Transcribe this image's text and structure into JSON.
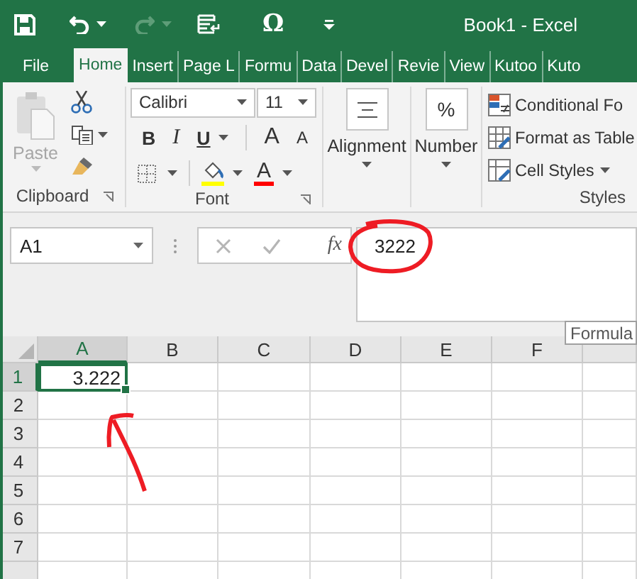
{
  "window": {
    "title": "Book1 - Excel"
  },
  "quick_access": [
    {
      "kind": "save",
      "disabled": false
    },
    {
      "kind": "undo",
      "disabled": false
    },
    {
      "kind": "redo",
      "disabled": true
    },
    {
      "kind": "touch",
      "disabled": false
    },
    {
      "kind": "symbol",
      "label": "Ω",
      "disabled": false
    },
    {
      "kind": "customize",
      "disabled": false
    }
  ],
  "tabs": [
    {
      "label": "File",
      "selected": false
    },
    {
      "label": "Home",
      "selected": true
    },
    {
      "label": "Insert",
      "selected": false
    },
    {
      "label": "Page L",
      "selected": false
    },
    {
      "label": "Formu",
      "selected": false
    },
    {
      "label": "Data",
      "selected": false
    },
    {
      "label": "Devel",
      "selected": false
    },
    {
      "label": "Revie",
      "selected": false
    },
    {
      "label": "View",
      "selected": false
    },
    {
      "label": "Kutoo",
      "selected": false
    },
    {
      "label": "Kuto",
      "selected": false
    }
  ],
  "ribbon": {
    "clipboard": {
      "label": "Clipboard",
      "paste": {
        "label": "Paste",
        "disabled": true
      }
    },
    "font": {
      "label": "Font",
      "font_name": "Calibri",
      "font_size": "11",
      "bold": "B",
      "italic": "I",
      "underline": "U",
      "grow": "A",
      "shrink": "A",
      "font_color": "A"
    },
    "alignment": {
      "label": "Alignment"
    },
    "number": {
      "symbol": "%",
      "label": "Number"
    },
    "styles": {
      "label": "Styles",
      "items": [
        {
          "label": "Conditional Fo",
          "dropdown": false
        },
        {
          "label": "Format as Table",
          "dropdown": false
        },
        {
          "label": "Cell Styles",
          "dropdown": true
        }
      ]
    }
  },
  "formula_bar": {
    "name_box": "A1",
    "fx": "fx",
    "formula": "3222",
    "tooltip": "Formula"
  },
  "sheet": {
    "columns": [
      {
        "label": "A",
        "selected": true
      },
      {
        "label": "B",
        "selected": false
      },
      {
        "label": "C",
        "selected": false
      },
      {
        "label": "D",
        "selected": false
      },
      {
        "label": "E",
        "selected": false
      },
      {
        "label": "F",
        "selected": false
      }
    ],
    "rows": [
      {
        "label": "1",
        "selected": true,
        "cells": [
          {
            "value": "3.222",
            "selected": true
          }
        ]
      },
      {
        "label": "2",
        "selected": false
      },
      {
        "label": "3",
        "selected": false
      },
      {
        "label": "4",
        "selected": false
      },
      {
        "label": "5",
        "selected": false
      },
      {
        "label": "6",
        "selected": false
      },
      {
        "label": "7",
        "selected": false
      }
    ]
  }
}
